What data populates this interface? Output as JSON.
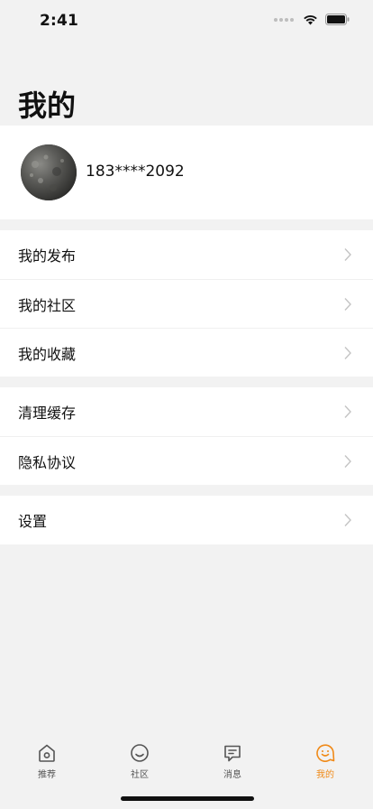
{
  "status_bar": {
    "time": "2:41"
  },
  "page": {
    "title": "我的"
  },
  "profile": {
    "phone": "183****2092"
  },
  "menu_groups": [
    {
      "items": [
        {
          "label": "我的发布"
        },
        {
          "label": "我的社区"
        },
        {
          "label": "我的收藏"
        }
      ]
    },
    {
      "items": [
        {
          "label": "清理缓存"
        },
        {
          "label": "隐私协议"
        }
      ]
    },
    {
      "items": [
        {
          "label": "设置"
        }
      ]
    }
  ],
  "tab_bar": {
    "tabs": [
      {
        "label": "推荐",
        "icon": "home-icon",
        "active": false
      },
      {
        "label": "社区",
        "icon": "smile-icon",
        "active": false
      },
      {
        "label": "消息",
        "icon": "message-icon",
        "active": false
      },
      {
        "label": "我的",
        "icon": "profile-face-icon",
        "active": true
      }
    ],
    "active_color": "#f08a18",
    "inactive_color": "#555555"
  }
}
